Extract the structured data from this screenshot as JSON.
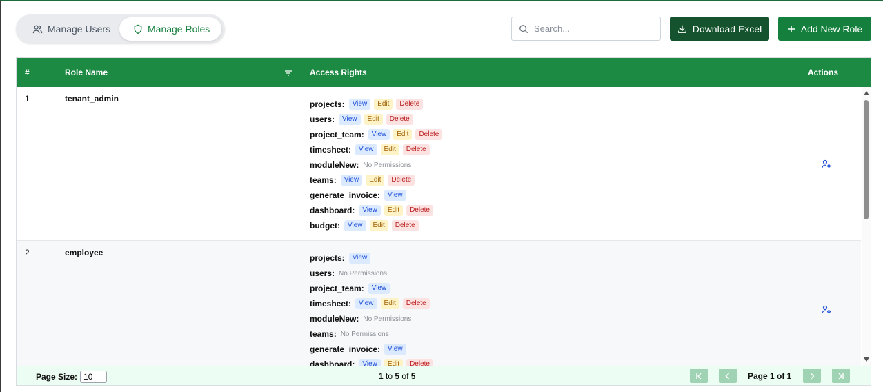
{
  "tabs": {
    "users_label": "Manage Users",
    "roles_label": "Manage Roles"
  },
  "search": {
    "placeholder": "Search..."
  },
  "buttons": {
    "download_label": "Download Excel",
    "add_label": "Add New Role"
  },
  "table": {
    "headers": {
      "num": "#",
      "role_name": "Role Name",
      "access_rights": "Access Rights",
      "actions": "Actions"
    },
    "rows": [
      {
        "num": "1",
        "role_name": "tenant_admin",
        "permissions": [
          {
            "module": "projects:",
            "rights": [
              "View",
              "Edit",
              "Delete"
            ]
          },
          {
            "module": "users:",
            "rights": [
              "View",
              "Edit",
              "Delete"
            ]
          },
          {
            "module": "project_team:",
            "rights": [
              "View",
              "Edit",
              "Delete"
            ]
          },
          {
            "module": "timesheet:",
            "rights": [
              "View",
              "Edit",
              "Delete"
            ]
          },
          {
            "module": "moduleNew:",
            "rights": []
          },
          {
            "module": "teams:",
            "rights": [
              "View",
              "Edit",
              "Delete"
            ]
          },
          {
            "module": "generate_invoice:",
            "rights": [
              "View"
            ]
          },
          {
            "module": "dashboard:",
            "rights": [
              "View",
              "Edit",
              "Delete"
            ]
          },
          {
            "module": "budget:",
            "rights": [
              "View",
              "Edit",
              "Delete"
            ]
          }
        ]
      },
      {
        "num": "2",
        "role_name": "employee",
        "permissions": [
          {
            "module": "projects:",
            "rights": [
              "View"
            ]
          },
          {
            "module": "users:",
            "rights": []
          },
          {
            "module": "project_team:",
            "rights": [
              "View"
            ]
          },
          {
            "module": "timesheet:",
            "rights": [
              "View",
              "Edit",
              "Delete"
            ]
          },
          {
            "module": "moduleNew:",
            "rights": []
          },
          {
            "module": "teams:",
            "rights": []
          },
          {
            "module": "generate_invoice:",
            "rights": [
              "View"
            ]
          },
          {
            "module": "dashboard:",
            "rights": [
              "View",
              "Edit",
              "Delete"
            ]
          }
        ]
      }
    ],
    "no_permissions_label": "No Permissions"
  },
  "footer": {
    "page_size_label": "Page Size:",
    "page_size_value": "10",
    "summary": {
      "from": "1",
      "to_word": "to",
      "to": "5",
      "of_word": "of",
      "total": "5"
    },
    "page_info": "Page 1 of 1"
  },
  "colors": {
    "primary": "#15803d",
    "header": "#1c8a43",
    "dark": "#14532d"
  }
}
